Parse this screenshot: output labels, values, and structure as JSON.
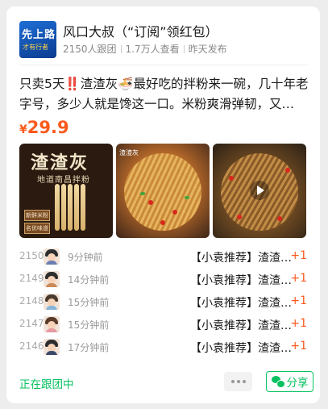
{
  "header": {
    "avatar_text_main": "先上路",
    "avatar_text_sub": "才有行者",
    "title": "风口大叔（“订阅”领红包）",
    "followers": "2150人跟团",
    "views": "1.7万人查看",
    "published": "昨天发布"
  },
  "post": {
    "description": "只卖5天‼️渣渣灰🍜最好吃的拌粉来一碗，几十年老字号，多少人就是馋这一口。米粉爽滑弹韧，又…",
    "price_currency": "¥",
    "price_value": "29.9"
  },
  "images": {
    "img1_title": "渣渣灰",
    "img1_subtitle": "地道南昌拌粉",
    "img1_label_a": "新鲜米粉",
    "img1_label_b": "名优味道",
    "img2_tag": "渣渣灰"
  },
  "orders": [
    {
      "no": "2150",
      "time": "9分钟前",
      "item": "【小袁推荐】渣渣灰南昌拌粉",
      "qty": "+1"
    },
    {
      "no": "2149",
      "time": "14分钟前",
      "item": "【小袁推荐】渣渣灰南昌拌粉",
      "qty": "+1"
    },
    {
      "no": "2148",
      "time": "15分钟前",
      "item": "【小袁推荐】渣渣灰南昌拌粉",
      "qty": "+1"
    },
    {
      "no": "2147",
      "time": "15分钟前",
      "item": "【小袁推荐】渣渣灰南昌拌粉",
      "qty": "+1"
    },
    {
      "no": "2146",
      "time": "17分钟前",
      "item": "【小袁推荐】渣渣灰南昌拌粉",
      "qty": "+1"
    }
  ],
  "footer": {
    "following_label": "正在跟团中",
    "share_label": "分享"
  },
  "colors": {
    "accent_green": "#07c160",
    "price_orange": "#fa5a1e"
  }
}
